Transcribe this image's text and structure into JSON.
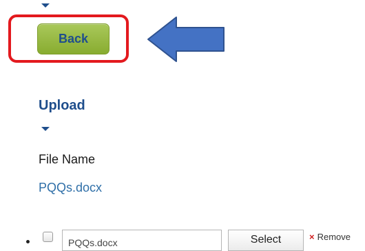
{
  "nav": {
    "back_label": "Back"
  },
  "upload": {
    "heading": "Upload",
    "file_name_label": "File Name",
    "file_name_value": "PQQs.docx"
  },
  "file_row": {
    "input_value": "PQQs.docx",
    "select_label": "Select",
    "remove_label": "Remove",
    "remove_icon": "×"
  },
  "colors": {
    "heading_blue": "#1f4e8c",
    "link_blue": "#2f6fa8",
    "button_green": "#9bbb45",
    "highlight_red": "#e3191e",
    "arrow_blue": "#4472c4",
    "remove_red": "#d02020"
  }
}
